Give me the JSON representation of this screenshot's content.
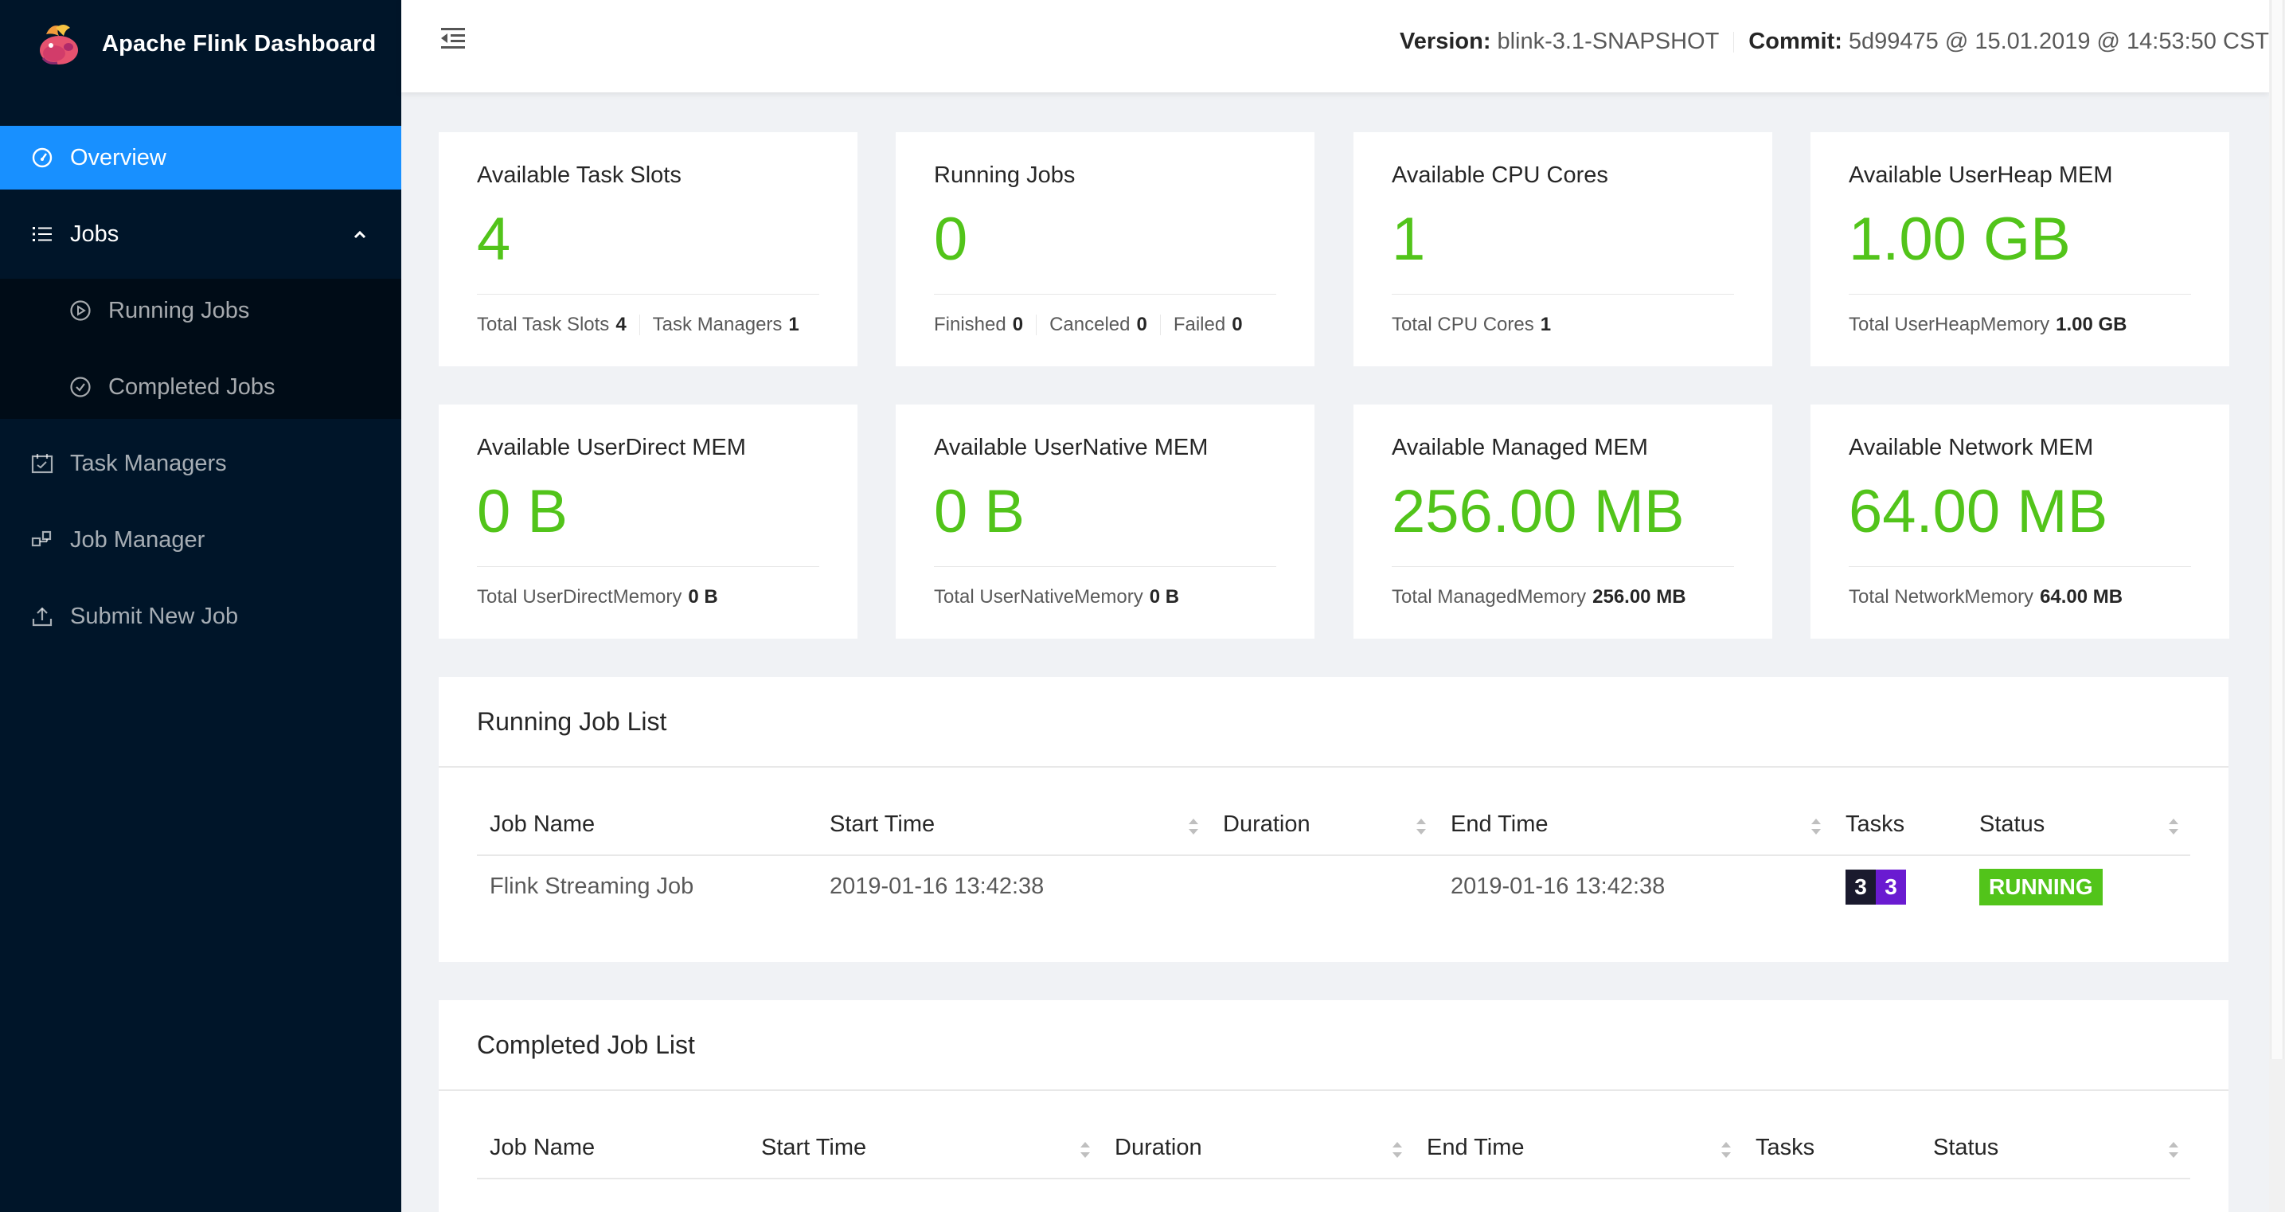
{
  "app": {
    "title": "Apache Flink Dashboard"
  },
  "colors": {
    "accent": "#1890ff",
    "sidebar": "#001529",
    "success": "#52c41a",
    "task_dark": "#1a1a2e",
    "task_purple": "#6a1bd1"
  },
  "sidebar": {
    "overview": "Overview",
    "jobs": "Jobs",
    "running_jobs": "Running Jobs",
    "completed_jobs": "Completed Jobs",
    "task_managers": "Task Managers",
    "job_manager": "Job Manager",
    "submit_new_job": "Submit New Job"
  },
  "header": {
    "version_label": "Version:",
    "version_value": "blink-3.1-SNAPSHOT",
    "commit_label": "Commit:",
    "commit_value": "5d99475 @ 15.01.2019 @ 14:53:50 CST"
  },
  "stats": [
    {
      "title": "Available Task Slots",
      "value": "4",
      "footer": [
        {
          "label": "Total Task Slots",
          "value": "4"
        },
        {
          "label": "Task Managers",
          "value": "1"
        }
      ]
    },
    {
      "title": "Running Jobs",
      "value": "0",
      "footer": [
        {
          "label": "Finished",
          "value": "0"
        },
        {
          "label": "Canceled",
          "value": "0"
        },
        {
          "label": "Failed",
          "value": "0"
        }
      ]
    },
    {
      "title": "Available CPU Cores",
      "value": "1",
      "footer": [
        {
          "label": "Total CPU Cores",
          "value": "1"
        }
      ]
    },
    {
      "title": "Available UserHeap MEM",
      "value": "1.00 GB",
      "footer": [
        {
          "label": "Total UserHeapMemory",
          "value": "1.00 GB"
        }
      ]
    },
    {
      "title": "Available UserDirect MEM",
      "value": "0 B",
      "footer": [
        {
          "label": "Total UserDirectMemory",
          "value": "0 B"
        }
      ]
    },
    {
      "title": "Available UserNative MEM",
      "value": "0 B",
      "footer": [
        {
          "label": "Total UserNativeMemory",
          "value": "0 B"
        }
      ]
    },
    {
      "title": "Available Managed MEM",
      "value": "256.00 MB",
      "footer": [
        {
          "label": "Total ManagedMemory",
          "value": "256.00 MB"
        }
      ]
    },
    {
      "title": "Available Network MEM",
      "value": "64.00 MB",
      "footer": [
        {
          "label": "Total NetworkMemory",
          "value": "64.00 MB"
        }
      ]
    }
  ],
  "running_list": {
    "title": "Running Job List",
    "columns": {
      "job_name": "Job Name",
      "start_time": "Start Time",
      "duration": "Duration",
      "end_time": "End Time",
      "tasks": "Tasks",
      "status": "Status"
    },
    "rows": [
      {
        "job_name": "Flink Streaming Job",
        "start_time": "2019-01-16 13:42:38",
        "duration": "",
        "end_time": "2019-01-16 13:42:38",
        "tasks_a": "3",
        "tasks_b": "3",
        "status": "RUNNING"
      }
    ]
  },
  "completed_list": {
    "title": "Completed Job List",
    "columns": {
      "job_name": "Job Name",
      "start_time": "Start Time",
      "duration": "Duration",
      "end_time": "End Time",
      "tasks": "Tasks",
      "status": "Status"
    }
  }
}
